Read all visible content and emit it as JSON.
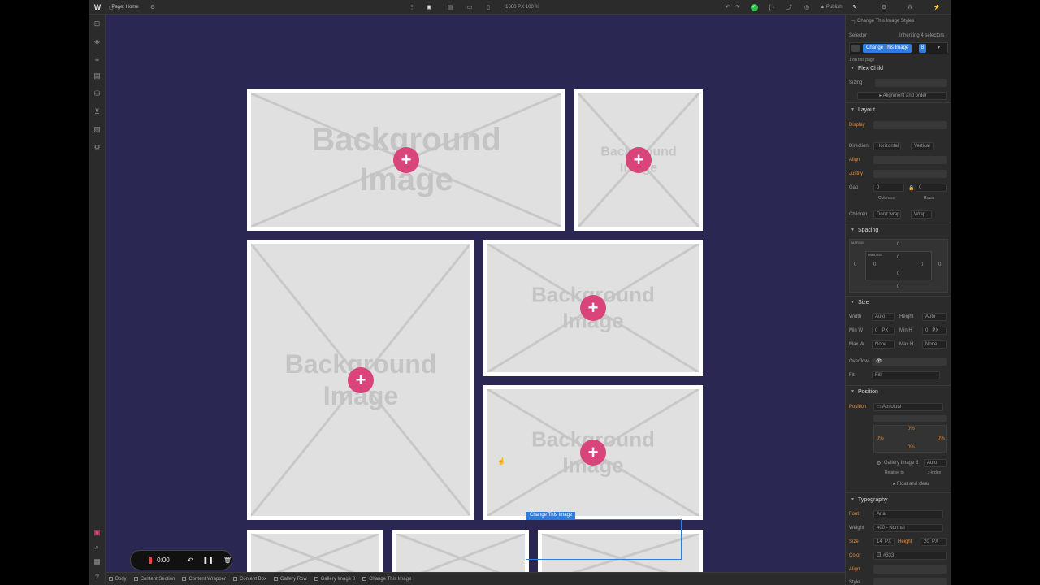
{
  "topbar": {
    "logo": "W",
    "page_label": "Page: Home",
    "canvas_size": "1680 PX  100 %",
    "publish": "Publish"
  },
  "canvas": {
    "tile_text": "Background\nImage",
    "plus": "+"
  },
  "panel": {
    "header_style_label": "Change This Image Styles",
    "selector_label": "Selector",
    "inheriting": "Inheriting 4 selectors",
    "selector_chip": "Change This Image",
    "selector_count": "8",
    "on_this_page": "1 on this page",
    "flex_child": "Flex Child",
    "sizing_label": "Sizing",
    "alignment_order": "Alignment and order",
    "layout": "Layout",
    "display_label": "Display",
    "direction_label": "Direction",
    "direction_h": "Horizontal",
    "direction_v": "Vertical",
    "align_label": "Align",
    "justify_label": "Justify",
    "gap_label": "Gap",
    "gap_col": "0",
    "gap_row": "0",
    "gap_unit": "PX",
    "columns_label": "Columns",
    "rows_label": "Rows",
    "children_label": "Children",
    "children_nowrap": "Don't wrap",
    "children_wrap": "Wrap",
    "spacing": "Spacing",
    "margin_label": "MARGIN",
    "padding_label": "PADDING",
    "zero": "0",
    "size": "Size",
    "width_label": "Width",
    "height_label": "Height",
    "auto": "Auto",
    "minw_label": "Min W",
    "minh_label": "Min H",
    "maxw_label": "Max W",
    "maxh_label": "Max H",
    "none": "None",
    "px": "PX",
    "overflow_label": "Overflow",
    "fit_label": "Fit",
    "fit_value": "Fill",
    "position": "Position",
    "position_label": "Position",
    "position_value": "Absolute",
    "zero_pct": "0%",
    "relative_ref": "Gallery Image 8",
    "relative_to": "Relative to",
    "z_index": "z-index",
    "float_clear": "Float and clear",
    "typography": "Typography",
    "font_label": "Font",
    "font_value": "Arial",
    "weight_label": "Weight",
    "weight_value": "400 - Normal",
    "size_label": "Size",
    "font_size": "14",
    "line_height_label": "Height",
    "line_height": "20",
    "color_label": "Color",
    "color_value": "#333",
    "talign_label": "Align",
    "style_label": "Style"
  },
  "breadcrumb": [
    "Body",
    "Content Section",
    "Content Wrapper",
    "Content Box",
    "Gallery Row",
    "Gallery Image 8",
    "Change This Image"
  ],
  "recorder": {
    "time": "0:00"
  },
  "selection_tag": "Change This Image",
  "colors": {
    "canvas_bg": "#2a2853",
    "plus_accent": "#d9457a",
    "selection": "#2f7de1",
    "panel_bg": "#2b2b2b"
  }
}
